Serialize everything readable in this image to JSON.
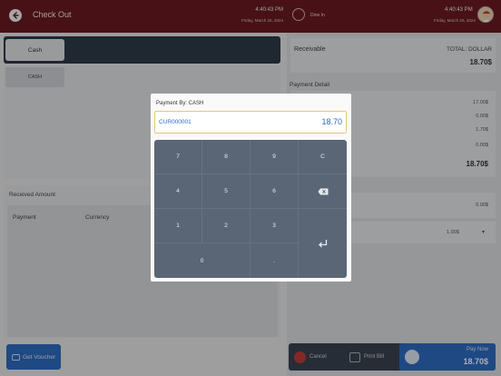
{
  "header": {
    "title": "Check Out",
    "time_left": "4:40:43 PM",
    "date_left": "Friday, March 20, 2024",
    "dine_in_label": "Dine In",
    "time_right": "4:40:43 PM",
    "date_right": "Friday, March 20, 2024"
  },
  "left": {
    "tab_label": "Cash",
    "payment_method": "CASH",
    "received_title": "Received Amount",
    "col_payment": "Payment",
    "col_currency": "Currency",
    "voucher_label": "Get Voucher"
  },
  "right": {
    "receivable_label": "Receivable",
    "total_label": "TOTAL: DOLLAR",
    "total_value": "18.70$",
    "payment_detail_label": "Payment Detail",
    "detail_values": [
      "17.00$",
      "0.00$",
      "1.70$",
      "0.00$"
    ],
    "detail_total": "18.70$",
    "paid_value": "0.00$",
    "change_value": "1.00$",
    "cancel_label": "Cancel",
    "print_label": "Print Bill",
    "paynow_label": "Pay Now",
    "paynow_amount": "18.70$"
  },
  "dialog": {
    "title": "Payment By: CASH",
    "code": "CUR000001",
    "amount": "18.70",
    "keys": [
      "7",
      "8",
      "9",
      "C",
      "4",
      "5",
      "6",
      "1",
      "2",
      "3",
      "0",
      "."
    ]
  },
  "colors": {
    "header": "#6b1a1f",
    "accent_blue": "#2e6cc2",
    "keypad": "#5a6676"
  }
}
